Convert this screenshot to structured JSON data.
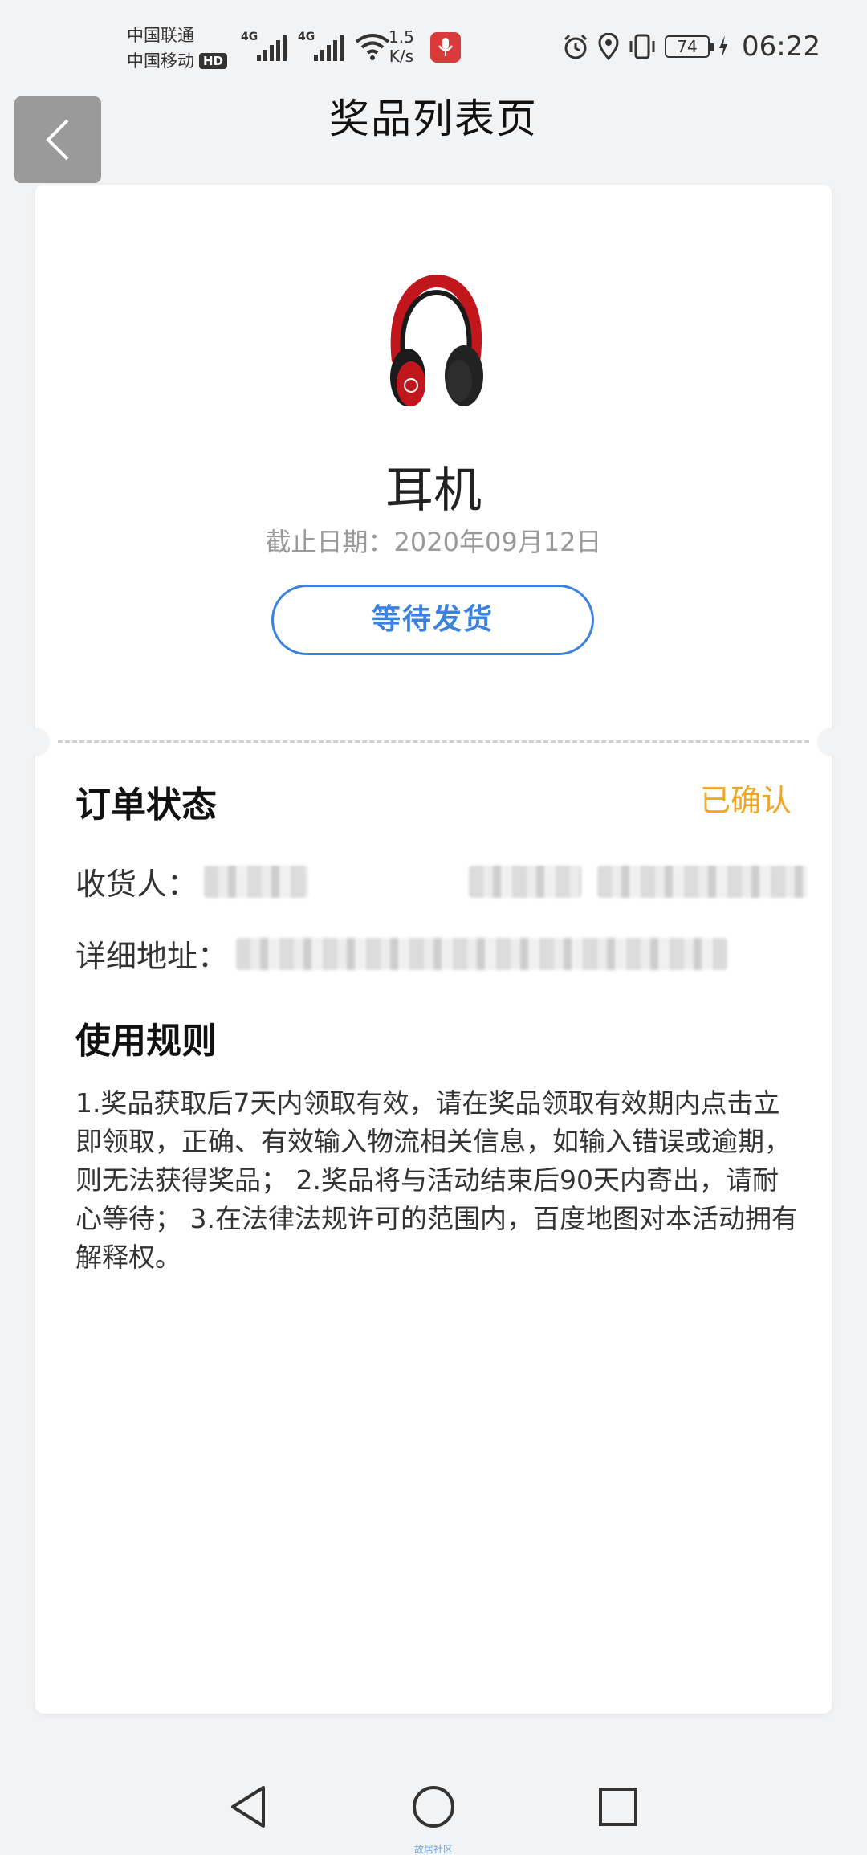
{
  "status_bar": {
    "carrier_1": "中国联通",
    "carrier_2": "中国移动",
    "hd_badge": "HD",
    "network_type_1": "4G",
    "network_type_2": "4G",
    "speed_value": "1.5",
    "speed_unit": "K/s",
    "battery": "74",
    "time": "06:22",
    "icons": [
      "signal-icon",
      "wifi-icon",
      "mic-icon",
      "alarm-icon",
      "location-icon",
      "vibrate-icon",
      "battery-icon",
      "charging-icon"
    ]
  },
  "header": {
    "title": "奖品列表页",
    "back_icon": "chevron-left-icon"
  },
  "prize": {
    "image_icon": "headphones-icon",
    "name": "耳机",
    "deadline": "截止日期：2020年09月12日",
    "status_button": "等待发货"
  },
  "order": {
    "title": "订单状态",
    "status_value": "已确认",
    "receiver_label": "收货人：",
    "address_label": "详细地址："
  },
  "rules": {
    "title": "使用规则",
    "text": "1.奖品获取后7天内领取有效，请在奖品领取有效期内点击立即领取，正确、有效输入物流相关信息，如输入错误或逾期，则无法获得奖品； 2.奖品将与活动结束后90天内寄出，请耐心等待； 3.在法律法规许可的范围内，百度地图对本活动拥有解释权。"
  },
  "nav_bar": {
    "caption": "故居社区",
    "icons": [
      "nav-back-icon",
      "nav-home-icon",
      "nav-recents-icon"
    ]
  },
  "colors": {
    "accent_blue": "#3b82e0",
    "status_orange": "#f0a528",
    "background": "#f2f3f5"
  }
}
